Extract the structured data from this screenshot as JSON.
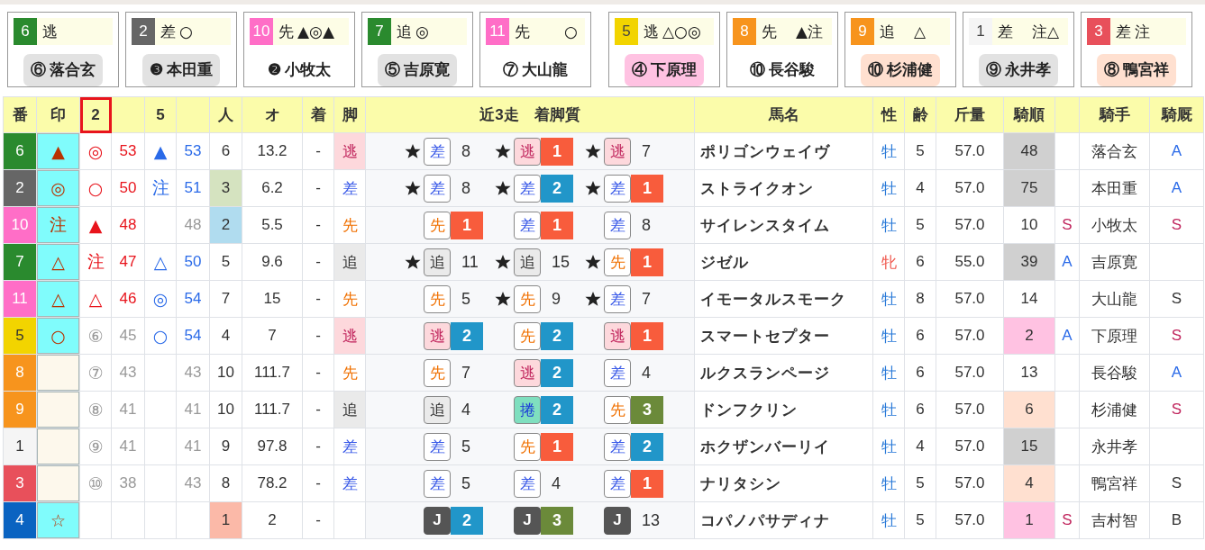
{
  "cards": [
    {
      "frame": {
        "num": "6",
        "color": "#2a8a2e"
      },
      "style": "逃",
      "jockey": {
        "name": "⑥ 落合玄",
        "color": "#e2e2e2"
      }
    },
    {
      "frame": {
        "num": "2",
        "color": "#666666"
      },
      "style": "差",
      "marks": "○",
      "jockey": {
        "name": "❸ 本田重",
        "color": "#e2e2e2"
      }
    },
    {
      "frame": {
        "num": "10",
        "color": "#ff6ec7"
      },
      "style": "先",
      "marks": "▲◎▲",
      "jockey": {
        "name": "❷ 小牧太"
      }
    },
    {
      "frame": {
        "num": "7",
        "color": "#2a8a2e"
      },
      "style": "追",
      "marks": "◎",
      "jockey": {
        "name": "⑤ 吉原寛",
        "color": "#e2e2e2"
      }
    },
    {
      "frame": {
        "num": "11",
        "color": "#ff6ec7"
      },
      "style": "先",
      "marks": "　　○",
      "jockey": {
        "name": "⑦ 大山龍"
      }
    },
    {
      "frame": {
        "num": "5",
        "color": "#f2d400"
      },
      "style": "逃",
      "marks": "△○◎",
      "jockey": {
        "name": "④ 下原理",
        "color": "#ffc2e2"
      }
    },
    {
      "frame": {
        "num": "8",
        "color": "#f7941d"
      },
      "style": "先",
      "marks": "　▲注",
      "jockey": {
        "name": "⑩ 長谷駿"
      }
    },
    {
      "frame": {
        "num": "9",
        "color": "#f7941d"
      },
      "style": "追",
      "marks": "　△",
      "jockey": {
        "name": "⑩ 杉浦健",
        "color": "#ffe0d0"
      }
    },
    {
      "frame": {
        "num": "1",
        "color": "#f5f5f5"
      },
      "style": "差",
      "marks": "　注△",
      "jockey": {
        "name": "⑨ 永井孝",
        "color": "#e2e2e2"
      }
    },
    {
      "frame": {
        "num": "3",
        "color": "#e8505b"
      },
      "style": "差",
      "marks": "注",
      "jockey": {
        "name": "⑧ 鴨宮祥",
        "color": "#ffe0d0"
      }
    }
  ],
  "table": {
    "headers": [
      {
        "label": "番",
        "selected": false
      },
      {
        "label": "印",
        "selected": false
      },
      {
        "label": "2",
        "selected": true
      },
      {
        "selected": false
      },
      {
        "label": "5",
        "selected": false
      },
      {
        "selected": false
      },
      {
        "label": "人",
        "selected": false
      },
      {
        "label": "オ",
        "selected": false
      },
      {
        "label": "着",
        "selected": false
      },
      {
        "label": "脚",
        "selected": false
      },
      {
        "label": "近3走　着脚質",
        "selected": false
      },
      {
        "label": "馬名",
        "selected": false
      },
      {
        "label": "性",
        "selected": false
      },
      {
        "label": "齢",
        "selected": false
      },
      {
        "label": "斤量",
        "selected": false
      },
      {
        "label": "騎順",
        "selected": false
      },
      {
        "selected": false
      },
      {
        "label": "騎手",
        "selected": false
      },
      {
        "label": "騎厩",
        "selected": false
      }
    ],
    "rows": [
      {
        "frame": {
          "num": "6",
          "color": "#2a8a2e"
        },
        "mark": "▲",
        "mark2": "◎",
        "score2": "53",
        "hi2": true,
        "mark5": "▲",
        "score5": "53",
        "hi5": true,
        "pop": {
          "text": "6"
        },
        "odds": "13.2",
        "finish": "-",
        "style": {
          "text": "逃",
          "kind": "nige"
        },
        "runs": [
          {
            "star": true,
            "kind": "sashi",
            "style": "差",
            "place": "8"
          },
          {
            "star": true,
            "kind": "nige",
            "style": "逃",
            "place": "1",
            "color": "#f85c3c"
          },
          {
            "star": true,
            "kind": "nige",
            "style": "逃",
            "place": "7"
          }
        ],
        "name": "ポリゴンウェイヴ",
        "sex": {
          "text": "牡",
          "kind": "male"
        },
        "age": "5",
        "weight": "57.0",
        "rank": {
          "text": "48",
          "color": "#d0d0d0"
        },
        "jockey": "落合玄",
        "stable": {
          "text": "A",
          "color": "#2a6ae8"
        }
      },
      {
        "frame": {
          "num": "2",
          "color": "#666666"
        },
        "mark": "◎",
        "mark2": "○",
        "score2": "50",
        "hi2": true,
        "mark5": "注",
        "score5": "51",
        "hi5": true,
        "pop": {
          "text": "3",
          "color": "#d5e3c0"
        },
        "odds": "6.2",
        "finish": "-",
        "style": {
          "text": "差",
          "kind": "sashi"
        },
        "runs": [
          {
            "star": true,
            "kind": "sashi",
            "style": "差",
            "place": "8"
          },
          {
            "star": true,
            "kind": "sashi",
            "style": "差",
            "place": "2",
            "color": "#2196c9"
          },
          {
            "star": true,
            "kind": "sashi",
            "style": "差",
            "place": "1",
            "color": "#f85c3c"
          }
        ],
        "name": "ストライクオン",
        "sex": {
          "text": "牡",
          "kind": "male"
        },
        "age": "4",
        "weight": "57.0",
        "rank": {
          "text": "75",
          "color": "#d0d0d0"
        },
        "jockey": "本田重",
        "stable": {
          "text": "A",
          "color": "#2a6ae8"
        }
      },
      {
        "frame": {
          "num": "10",
          "color": "#ff6ec7"
        },
        "mark": "注",
        "mark2": "▲",
        "score2": "48",
        "hi2": true,
        "score5": "48",
        "hi5": false,
        "pop": {
          "text": "2",
          "color": "#b0dcef"
        },
        "odds": "5.5",
        "finish": "-",
        "style": {
          "text": "先",
          "kind": "senko"
        },
        "runs": [
          {
            "star": false,
            "kind": "senko",
            "style": "先",
            "place": "1",
            "color": "#f85c3c"
          },
          {
            "star": false,
            "kind": "sashi",
            "style": "差",
            "place": "1",
            "color": "#f85c3c"
          },
          {
            "star": false,
            "kind": "sashi",
            "style": "差",
            "place": "8"
          }
        ],
        "name": "サイレンスタイム",
        "sex": {
          "text": "牡",
          "kind": "male"
        },
        "age": "5",
        "weight": "57.0",
        "rank": {
          "text": "10"
        },
        "grade": {
          "text": "S",
          "color": "#c0245c"
        },
        "jockey": "小牧太",
        "stable": {
          "text": "S",
          "color": "#c0245c"
        }
      },
      {
        "frame": {
          "num": "7",
          "color": "#2a8a2e"
        },
        "mark": "△",
        "mark2": "注",
        "score2": "47",
        "hi2": true,
        "mark5": "△",
        "score5": "50",
        "hi5": true,
        "pop": {
          "text": "5"
        },
        "odds": "9.6",
        "finish": "-",
        "style": {
          "text": "追",
          "kind": "oikomi"
        },
        "runs": [
          {
            "star": true,
            "kind": "oikomi",
            "style": "追",
            "place": "11"
          },
          {
            "star": true,
            "kind": "oikomi",
            "style": "追",
            "place": "15"
          },
          {
            "star": true,
            "kind": "senko",
            "style": "先",
            "place": "1",
            "color": "#f85c3c"
          }
        ],
        "name": "ジゼル",
        "sex": {
          "text": "牝",
          "kind": "female"
        },
        "age": "6",
        "weight": "55.0",
        "rank": {
          "text": "39",
          "color": "#d0d0d0"
        },
        "grade": {
          "text": "A",
          "color": "#2a6ae8"
        },
        "jockey": "吉原寛"
      },
      {
        "frame": {
          "num": "11",
          "color": "#ff6ec7"
        },
        "mark": "△",
        "mark2": "△",
        "score2": "46",
        "hi2": true,
        "mark5": "◎",
        "score5": "54",
        "hi5": true,
        "pop": {
          "text": "7"
        },
        "odds": "15",
        "finish": "-",
        "style": {
          "text": "先",
          "kind": "senko"
        },
        "runs": [
          {
            "star": false,
            "kind": "senko",
            "style": "先",
            "place": "5"
          },
          {
            "star": true,
            "kind": "senko",
            "style": "先",
            "place": "9"
          },
          {
            "star": true,
            "kind": "sashi",
            "style": "差",
            "place": "7"
          }
        ],
        "name": "イモータルスモーク",
        "sex": {
          "text": "牡",
          "kind": "male"
        },
        "age": "8",
        "weight": "57.0",
        "rank": {
          "text": "14"
        },
        "jockey": "大山龍",
        "stable": {
          "text": "S",
          "color": "#333333"
        }
      },
      {
        "frame": {
          "num": "5",
          "color": "#f2d400"
        },
        "mark": "○",
        "mark2": "⑥",
        "score2": "45",
        "hi2": false,
        "mark5": "○",
        "score5": "54",
        "hi5": true,
        "pop": {
          "text": "4"
        },
        "odds": "7",
        "finish": "-",
        "style": {
          "text": "逃",
          "kind": "nige"
        },
        "runs": [
          {
            "star": false,
            "kind": "nige",
            "style": "逃",
            "place": "2",
            "color": "#2196c9"
          },
          {
            "star": false,
            "kind": "senko",
            "style": "先",
            "place": "2",
            "color": "#2196c9"
          },
          {
            "star": false,
            "kind": "nige",
            "style": "逃",
            "place": "1",
            "color": "#f85c3c"
          }
        ],
        "name": "スマートセプター",
        "sex": {
          "text": "牡",
          "kind": "male"
        },
        "age": "6",
        "weight": "57.0",
        "rank": {
          "text": "2",
          "color": "#ffc2e2"
        },
        "grade": {
          "text": "A",
          "color": "#2a6ae8"
        },
        "jockey": "下原理",
        "stable": {
          "text": "S",
          "color": "#c0245c"
        }
      },
      {
        "frame": {
          "num": "8",
          "color": "#f7941d"
        },
        "mark2": "⑦",
        "score2": "43",
        "hi2": false,
        "score5": "43",
        "hi5": false,
        "pop": {
          "text": "10"
        },
        "odds": "111.7",
        "finish": "-",
        "style": {
          "text": "先",
          "kind": "senko"
        },
        "runs": [
          {
            "star": false,
            "kind": "senko",
            "style": "先",
            "place": "7"
          },
          {
            "star": false,
            "kind": "nige",
            "style": "逃",
            "place": "2",
            "color": "#2196c9"
          },
          {
            "star": false,
            "kind": "sashi",
            "style": "差",
            "place": "4"
          }
        ],
        "name": "ルクスランページ",
        "sex": {
          "text": "牡",
          "kind": "male"
        },
        "age": "6",
        "weight": "57.0",
        "rank": {
          "text": "13"
        },
        "jockey": "長谷駿",
        "stable": {
          "text": "A",
          "color": "#2a6ae8"
        }
      },
      {
        "frame": {
          "num": "9",
          "color": "#f7941d"
        },
        "mark2": "⑧",
        "score2": "41",
        "hi2": false,
        "score5": "41",
        "hi5": false,
        "pop": {
          "text": "10"
        },
        "odds": "111.7",
        "finish": "-",
        "style": {
          "text": "追",
          "kind": "oikomi"
        },
        "runs": [
          {
            "star": false,
            "kind": "oikomi",
            "style": "追",
            "place": "4"
          },
          {
            "star": false,
            "kind": "makuri",
            "style": "捲",
            "place": "2",
            "color": "#2196c9"
          },
          {
            "star": false,
            "kind": "senko",
            "style": "先",
            "place": "3",
            "color": "#6b8a3a"
          }
        ],
        "name": "ドンフクリン",
        "sex": {
          "text": "牡",
          "kind": "male"
        },
        "age": "6",
        "weight": "57.0",
        "rank": {
          "text": "6",
          "color": "#ffe0d0"
        },
        "jockey": "杉浦健",
        "stable": {
          "text": "S",
          "color": "#c0245c"
        }
      },
      {
        "frame": {
          "num": "1",
          "color": "#f5f5f5"
        },
        "mark2": "⑨",
        "score2": "41",
        "hi2": false,
        "score5": "41",
        "hi5": false,
        "pop": {
          "text": "9"
        },
        "odds": "97.8",
        "finish": "-",
        "style": {
          "text": "差",
          "kind": "sashi"
        },
        "runs": [
          {
            "star": false,
            "kind": "sashi",
            "style": "差",
            "place": "5"
          },
          {
            "star": false,
            "kind": "senko",
            "style": "先",
            "place": "1",
            "color": "#f85c3c"
          },
          {
            "star": false,
            "kind": "sashi",
            "style": "差",
            "place": "2",
            "color": "#2196c9"
          }
        ],
        "name": "ホクザンバーリイ",
        "sex": {
          "text": "牡",
          "kind": "male"
        },
        "age": "4",
        "weight": "57.0",
        "rank": {
          "text": "15",
          "color": "#d0d0d0"
        },
        "jockey": "永井孝"
      },
      {
        "frame": {
          "num": "3",
          "color": "#e8505b"
        },
        "mark2": "⑩",
        "score2": "38",
        "hi2": false,
        "score5": "43",
        "hi5": false,
        "pop": {
          "text": "8"
        },
        "odds": "78.2",
        "finish": "-",
        "style": {
          "text": "差",
          "kind": "sashi"
        },
        "runs": [
          {
            "star": false,
            "kind": "sashi",
            "style": "差",
            "place": "5"
          },
          {
            "star": false,
            "kind": "sashi",
            "style": "差",
            "place": "4"
          },
          {
            "star": false,
            "kind": "sashi",
            "style": "差",
            "place": "1",
            "color": "#f85c3c"
          }
        ],
        "name": "ナリタシン",
        "sex": {
          "text": "牡",
          "kind": "male"
        },
        "age": "5",
        "weight": "57.0",
        "rank": {
          "text": "4",
          "color": "#ffe0d0"
        },
        "jockey": "鴨宮祥",
        "stable": {
          "text": "S",
          "color": "#333333"
        }
      },
      {
        "frame": {
          "num": "4",
          "color": "#0a63c1"
        },
        "mark": "☆",
        "pop": {
          "text": "1",
          "color": "#fbb9a8"
        },
        "odds": "2",
        "finish": "-",
        "runs": [
          {
            "star": false,
            "kind": "jump",
            "style": "J",
            "place": "2",
            "color": "#2196c9"
          },
          {
            "star": false,
            "kind": "jump",
            "style": "J",
            "place": "3",
            "color": "#6b8a3a"
          },
          {
            "star": false,
            "kind": "jump",
            "style": "J",
            "place": "13"
          }
        ],
        "name": "コパノパサディナ",
        "sex": {
          "text": "牡",
          "kind": "male"
        },
        "age": "5",
        "weight": "57.0",
        "rank": {
          "text": "1",
          "color": "#ffc2e2"
        },
        "grade": {
          "text": "S",
          "color": "#c0245c"
        },
        "jockey": "吉村智",
        "stable": {
          "text": "B",
          "color": "#333333"
        }
      }
    ]
  }
}
